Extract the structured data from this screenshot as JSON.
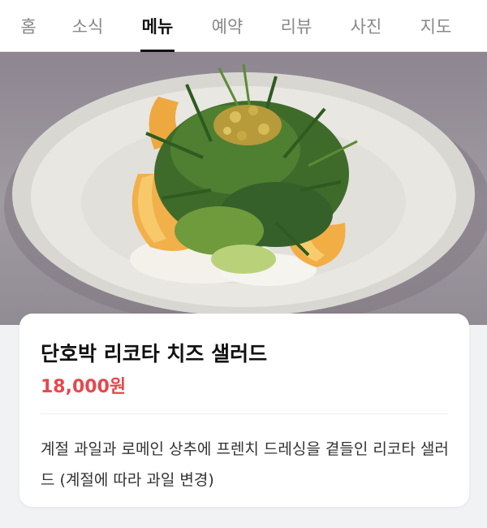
{
  "tabs": [
    {
      "label": "홈",
      "active": false
    },
    {
      "label": "소식",
      "active": false
    },
    {
      "label": "메뉴",
      "active": true
    },
    {
      "label": "예약",
      "active": false
    },
    {
      "label": "리뷰",
      "active": false
    },
    {
      "label": "사진",
      "active": false
    },
    {
      "label": "지도",
      "active": false
    }
  ],
  "menu_item": {
    "name": "단호박 리코타 치즈 샐러드",
    "price": "18,000원",
    "description": "계절 과일과 로메인 상추에 프렌치 드레싱을 곁들인 리코타 샐러드 (계절에 따라 과일 변경)"
  },
  "colors": {
    "price": "#e5484d",
    "active_tab": "#111111",
    "inactive_tab": "#888888"
  }
}
